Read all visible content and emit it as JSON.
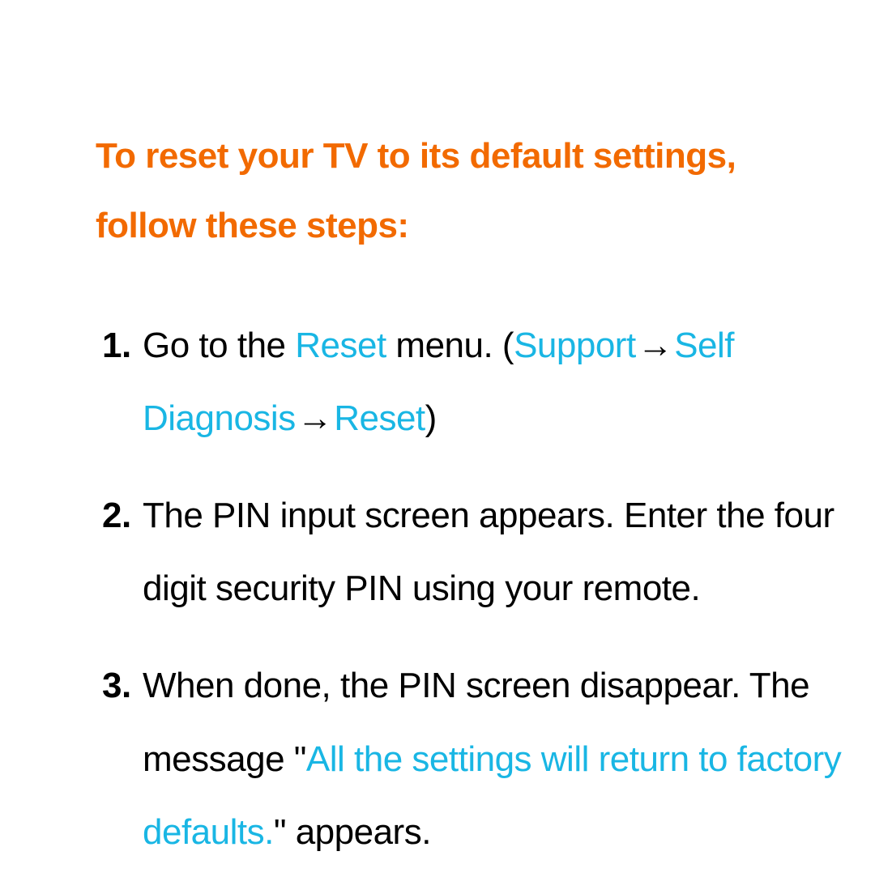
{
  "colors": {
    "accent_orange": "#f26a00",
    "accent_cyan": "#19b6e4",
    "text": "#000000"
  },
  "intro": "To reset your TV to its default settings, follow these steps:",
  "steps": {
    "s1": {
      "num": "1.",
      "t1": "Go to the ",
      "reset1": "Reset",
      "t2": " menu. (",
      "support": "Support",
      "arrow": " → ",
      "selfdiag": "Self Diagnosis",
      "reset2": "Reset",
      "t3": ")"
    },
    "s2": {
      "num": "2.",
      "text": "The PIN input screen appears. Enter the four digit security PIN using your remote."
    },
    "s3": {
      "num": "3.",
      "t1": "When done, the PIN screen disappear. The message \"",
      "msg": "All the settings will return to factory defaults.",
      "t2": "\" appears."
    }
  }
}
